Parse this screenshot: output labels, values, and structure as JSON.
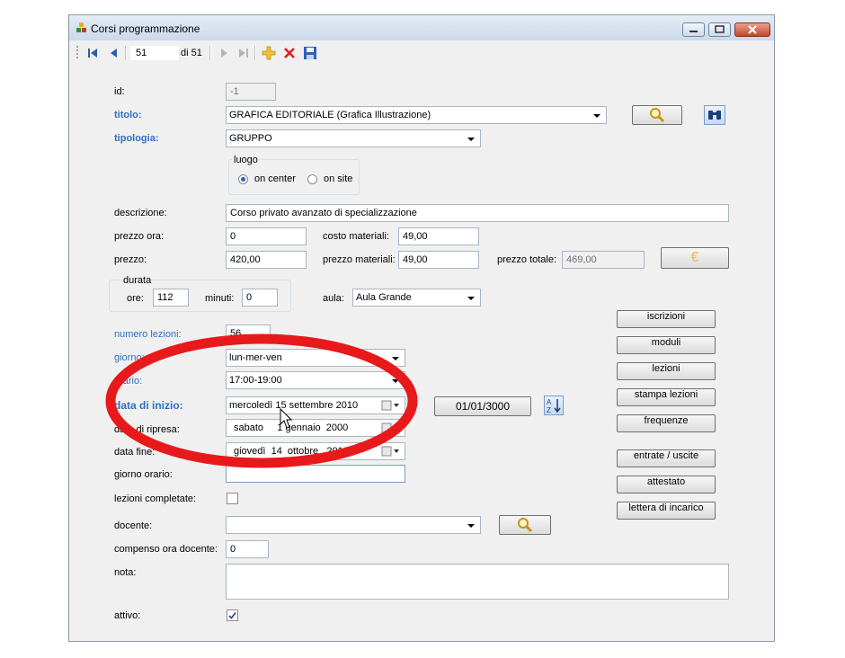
{
  "window": {
    "title": "Corsi programmazione"
  },
  "toolbar": {
    "record_value": "51",
    "of_label": "di 51"
  },
  "form": {
    "id_label": "id:",
    "id_value": "-1",
    "titolo_label": "titolo:",
    "titolo_value": "GRAFICA EDITORIALE (Grafica Illustrazione)",
    "tipologia_label": "tipologia:",
    "tipologia_value": "GRUPPO",
    "luogo_label": "luogo",
    "luogo_options": [
      "on center",
      "on site"
    ],
    "luogo_selected": "on center",
    "descrizione_label": "descrizione:",
    "descrizione_value": "Corso privato avanzato di specializzazione",
    "prezzo_ora_label": "prezzo ora:",
    "prezzo_ora_value": "0",
    "costo_materiali_label": "costo materiali:",
    "costo_materiali_value": "49,00",
    "prezzo_label": "prezzo:",
    "prezzo_value": "420,00",
    "prezzo_materiali_label": "prezzo materiali:",
    "prezzo_materiali_value": "49,00",
    "prezzo_totale_label": "prezzo totale:",
    "prezzo_totale_value": "469,00",
    "euro_symbol": "€",
    "durata_label": "durata",
    "ore_label": "ore:",
    "ore_value": "112",
    "minuti_label": "minuti:",
    "minuti_value": "0",
    "aula_label": "aula:",
    "aula_value": "Aula Grande",
    "numero_lezioni_label": "numero lezioni:",
    "numero_lezioni_value": "56",
    "giorno_label": "giorno:",
    "giorno_value": "lun-mer-ven",
    "orario_label": "orario:",
    "orario_value": "17:00-19:00",
    "data_inizio_label": "data di inizio:",
    "data_inizio_value": "mercoledì 15 settembre 2010",
    "data_ripresa_label": "data di ripresa:",
    "data_ripresa_value": "sabato     1 gennaio  2000",
    "data_fine_label": "data fine:",
    "data_fine_value": "giovedì  14  ottobre   2010",
    "giorno_orario_label": "giorno orario:",
    "giorno_orario_value": "",
    "lezioni_completate_label": "lezioni completate:",
    "lezioni_completate_checked": false,
    "docente_label": "docente:",
    "docente_value": "",
    "compenso_label": "compenso ora docente:",
    "compenso_value": "0",
    "nota_label": "nota:",
    "nota_value": "",
    "attivo_label": "attivo:",
    "attivo_checked": true,
    "date_button_label": "01/01/3000",
    "sort_icon_text": "A Z"
  },
  "side_buttons": {
    "iscrizioni": "iscrizioni",
    "moduli": "moduli",
    "lezioni": "lezioni",
    "stampa_lezioni": "stampa lezioni",
    "frequenze": "frequenze",
    "entrate_uscite": "entrate / uscite",
    "attestato": "attestato",
    "lettera": "lettera di incarico"
  },
  "colors": {
    "label_blue": "#2f6fc2",
    "annotation_red": "#e8191a"
  }
}
